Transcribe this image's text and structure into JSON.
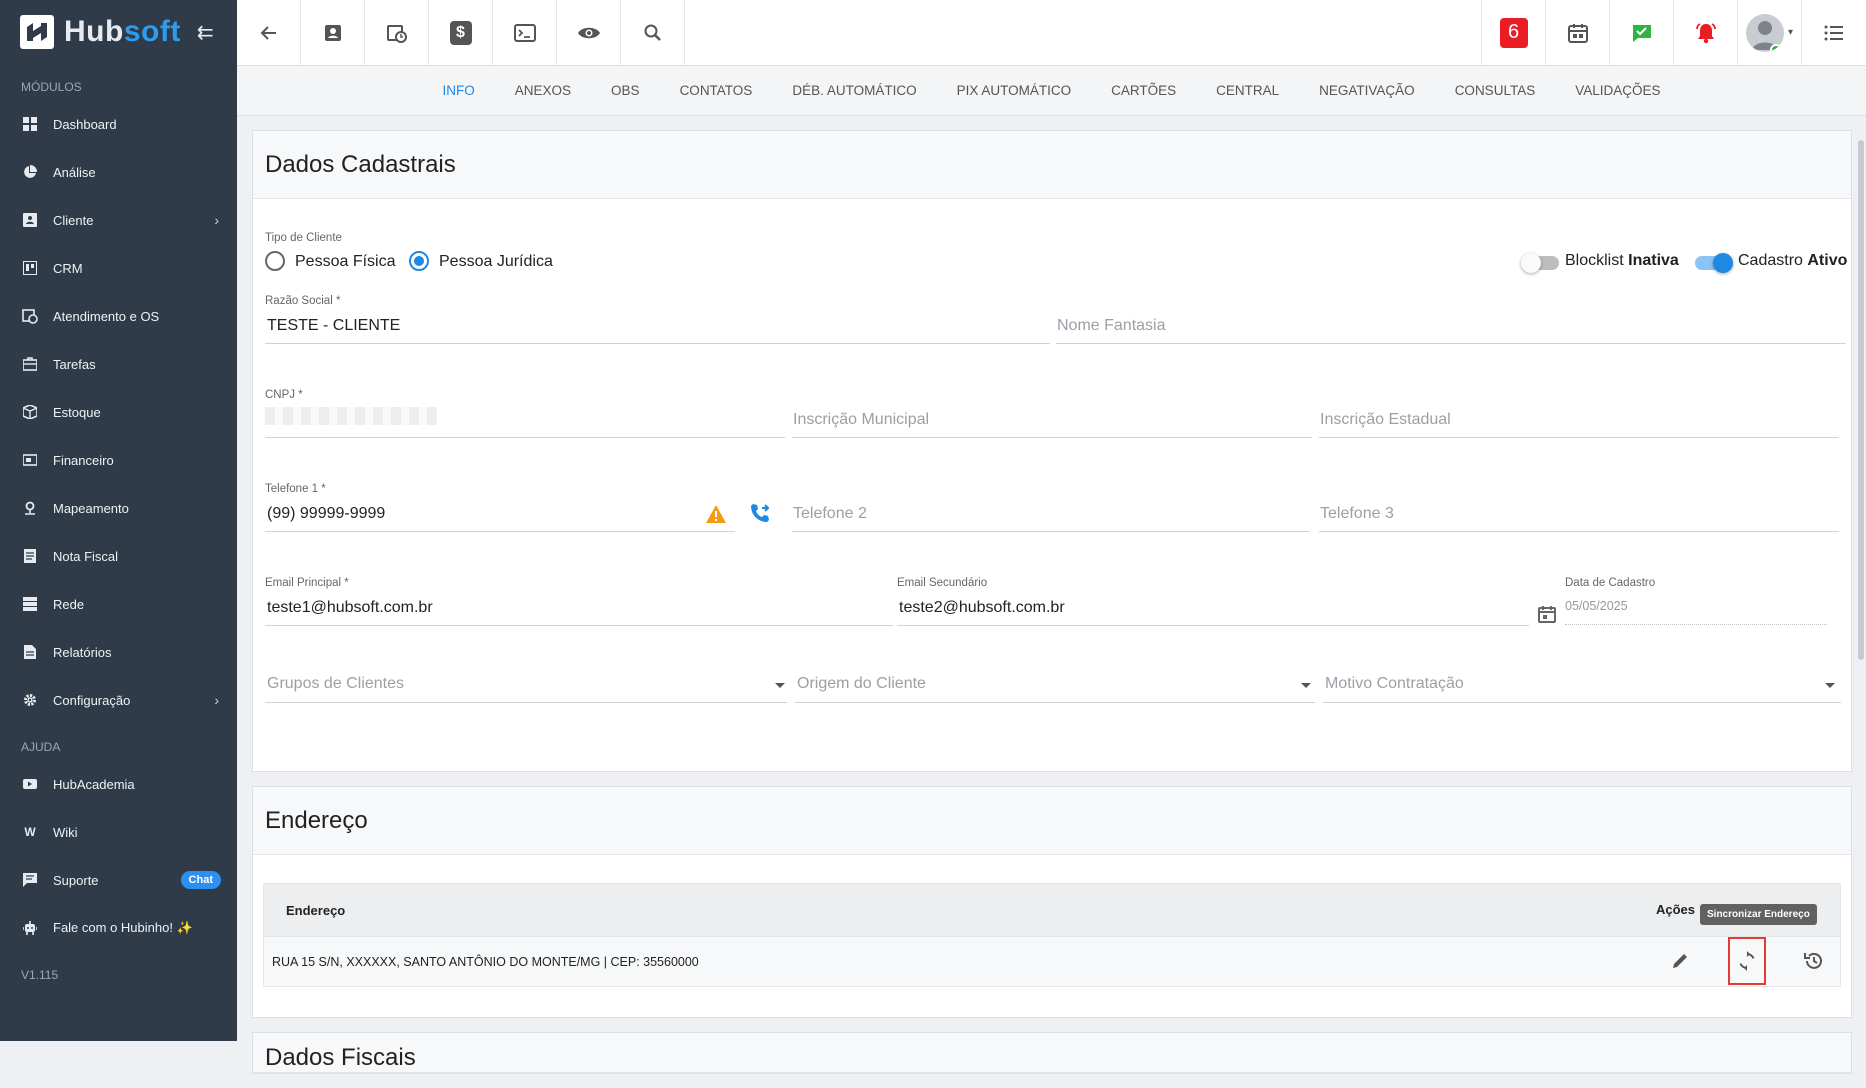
{
  "sidebar": {
    "brand_hub": "Hub",
    "brand_soft": "soft",
    "modules_label": "MÓDULOS",
    "items": [
      {
        "label": "Dashboard",
        "icon": "dashboard-icon"
      },
      {
        "label": "Análise",
        "icon": "pie-chart-icon"
      },
      {
        "label": "Cliente",
        "icon": "contact-card-icon",
        "chevron": true
      },
      {
        "label": "CRM",
        "icon": "kanban-icon"
      },
      {
        "label": "Atendimento e OS",
        "icon": "calendar-clock-icon"
      },
      {
        "label": "Tarefas",
        "icon": "briefcase-icon"
      },
      {
        "label": "Estoque",
        "icon": "box-icon"
      },
      {
        "label": "Financeiro",
        "icon": "money-icon"
      },
      {
        "label": "Mapeamento",
        "icon": "map-pin-icon"
      },
      {
        "label": "Nota Fiscal",
        "icon": "invoice-icon"
      },
      {
        "label": "Rede",
        "icon": "server-icon"
      },
      {
        "label": "Relatórios",
        "icon": "report-icon"
      },
      {
        "label": "Configuração",
        "icon": "gear-icon",
        "chevron": true
      }
    ],
    "help_label": "AJUDA",
    "help_items": [
      {
        "label": "HubAcademia",
        "icon": "video-icon"
      },
      {
        "label": "Wiki",
        "icon": "wiki-icon"
      },
      {
        "label": "Suporte",
        "icon": "chat-icon",
        "badge": "Chat"
      },
      {
        "label": "Fale com o Hubinho! ✨",
        "icon": "robot-icon"
      }
    ],
    "version": "V1.115"
  },
  "topbar": {
    "notification_count": "6",
    "colors": {
      "dollar_bg": "#555555",
      "check_green": "#2fb344",
      "bell_red": "#ec1c24"
    }
  },
  "tabs": [
    {
      "label": "INFO",
      "active": true
    },
    {
      "label": "ANEXOS"
    },
    {
      "label": "OBS"
    },
    {
      "label": "CONTATOS"
    },
    {
      "label": "DÉB. AUTOMÁTICO"
    },
    {
      "label": "PIX AUTOMÁTICO"
    },
    {
      "label": "CARTÕES"
    },
    {
      "label": "CENTRAL"
    },
    {
      "label": "NEGATIVAÇÃO"
    },
    {
      "label": "CONSULTAS"
    },
    {
      "label": "VALIDAÇÕES"
    }
  ],
  "dados": {
    "title": "Dados Cadastrais",
    "tipo_label": "Tipo de Cliente",
    "pessoa_fisica": "Pessoa Física",
    "pessoa_juridica": "Pessoa Jurídica",
    "blocklist_label": "Blocklist",
    "blocklist_state": "Inativa",
    "cadastro_label": "Cadastro",
    "cadastro_state": "Ativo",
    "razao_label": "Razão Social *",
    "razao_value": "TESTE - CLIENTE",
    "fantasia_ph": "Nome Fantasia",
    "cnpj_label": "CNPJ *",
    "insc_mun_ph": "Inscrição Municipal",
    "insc_est_ph": "Inscrição Estadual",
    "tel1_label": "Telefone 1 *",
    "tel1_value": "(99) 99999-9999",
    "tel2_ph": "Telefone 2",
    "tel3_ph": "Telefone 3",
    "email1_label": "Email Principal *",
    "email1_value": "teste1@hubsoft.com.br",
    "email2_label": "Email Secundário",
    "email2_value": "teste2@hubsoft.com.br",
    "data_label": "Data de Cadastro",
    "data_value": "05/05/2025",
    "grupos_ph": "Grupos de Clientes",
    "origem_ph": "Origem do Cliente",
    "motivo_ph": "Motivo Contratação"
  },
  "endereco": {
    "title": "Endereço",
    "col_endereco": "Endereço",
    "col_acoes": "Ações",
    "tooltip": "Sincronizar Endereço",
    "row": "RUA 15 S/N, XXXXXX, SANTO ANTÔNIO DO MONTE/MG | CEP: 35560000"
  },
  "fiscais": {
    "title": "Dados Fiscais"
  }
}
